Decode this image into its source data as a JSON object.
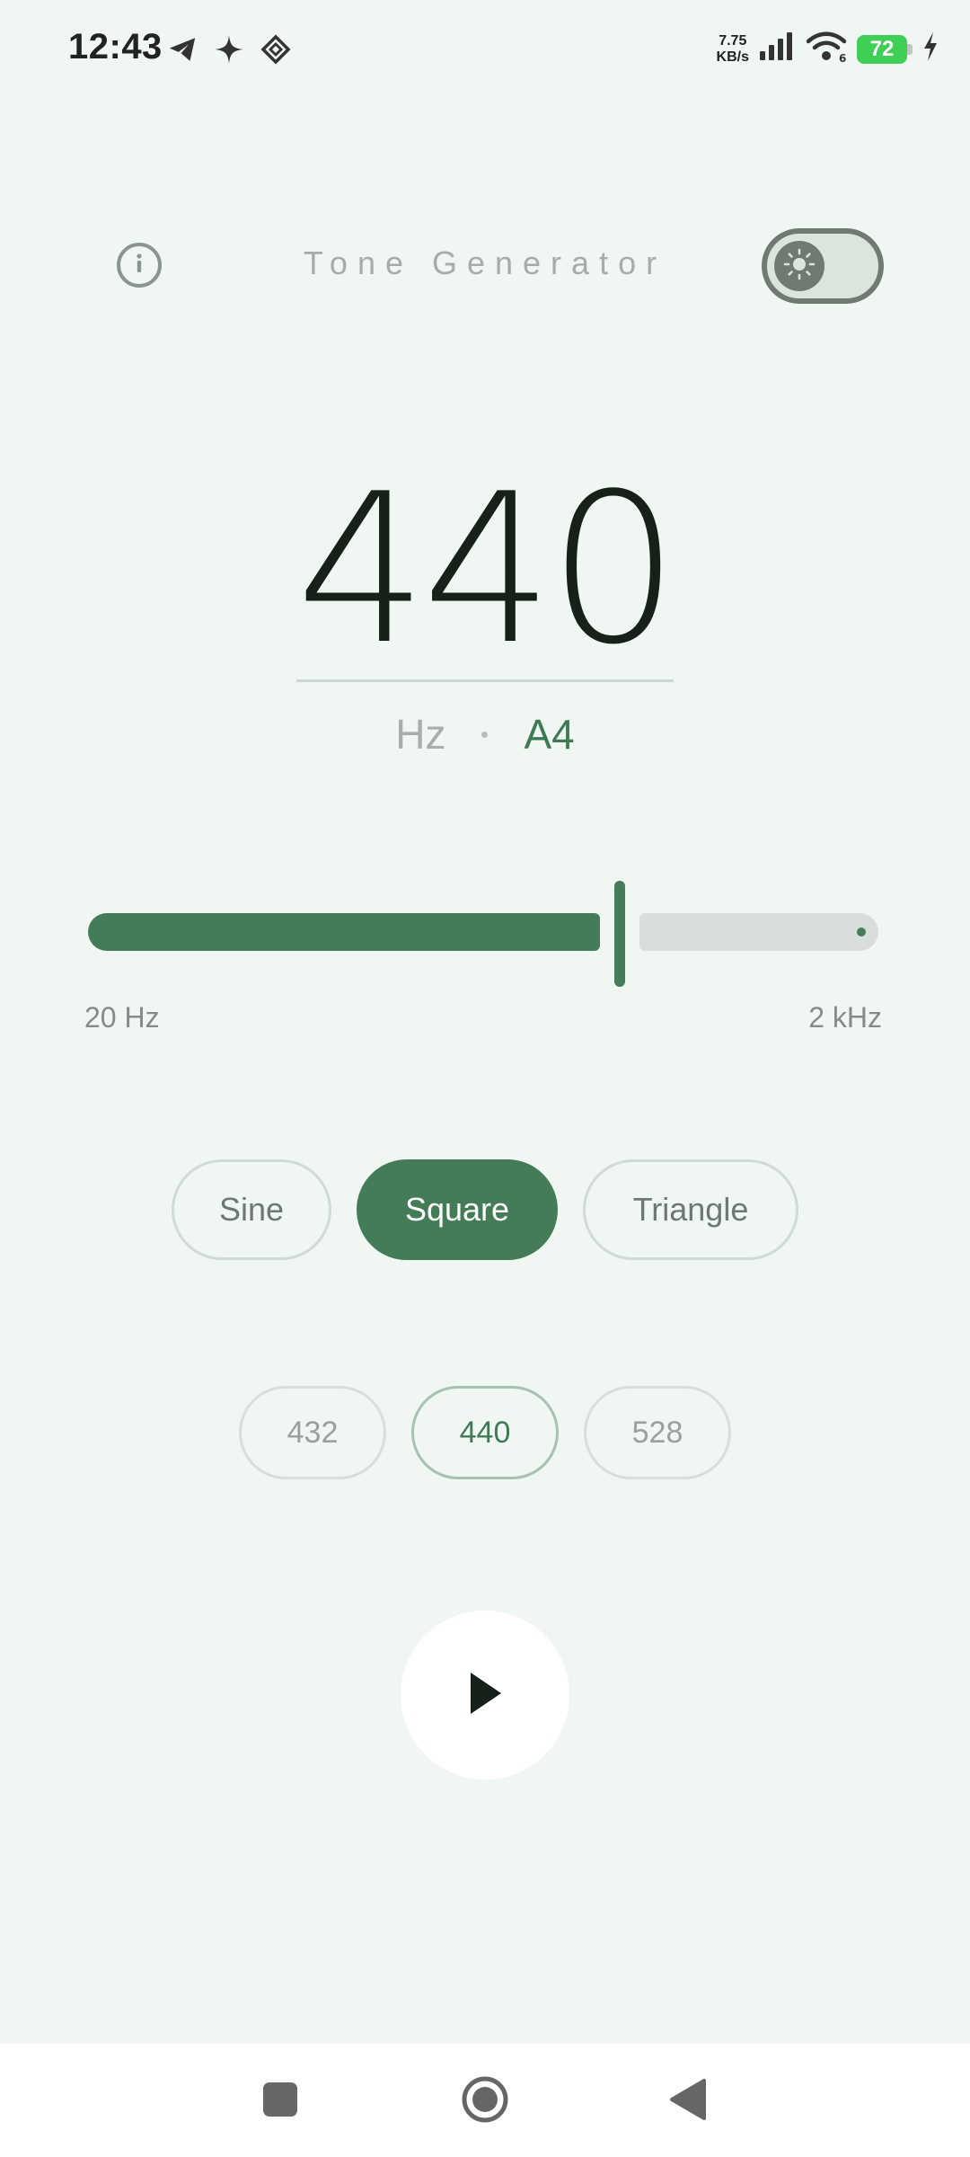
{
  "status_bar": {
    "time": "12:43",
    "net_speed_value": "7.75",
    "net_speed_unit": "KB/s",
    "battery_level": "72",
    "left_icons": [
      "telegram-icon",
      "sparkle-icon",
      "vpn-icon"
    ],
    "right_icons": [
      "signal-icon",
      "wifi-icon",
      "battery-icon",
      "charging-icon"
    ]
  },
  "header": {
    "title": "Tone Generator",
    "info_icon": "info-icon",
    "theme_icon": "sun-icon"
  },
  "frequency": {
    "value": "440",
    "unit": "Hz",
    "note": "A4"
  },
  "slider": {
    "min_label": "20 Hz",
    "max_label": "2 kHz",
    "fill_fraction": 0.66
  },
  "waveforms": [
    {
      "label": "Sine",
      "selected": false
    },
    {
      "label": "Square",
      "selected": true
    },
    {
      "label": "Triangle",
      "selected": false
    }
  ],
  "presets": [
    {
      "label": "432",
      "selected": false
    },
    {
      "label": "440",
      "selected": true
    },
    {
      "label": "528",
      "selected": false
    }
  ],
  "colors": {
    "background": "#f0f6f2",
    "accent": "#447c58",
    "track": "#d8dfda",
    "battery": "#3fcf57"
  }
}
